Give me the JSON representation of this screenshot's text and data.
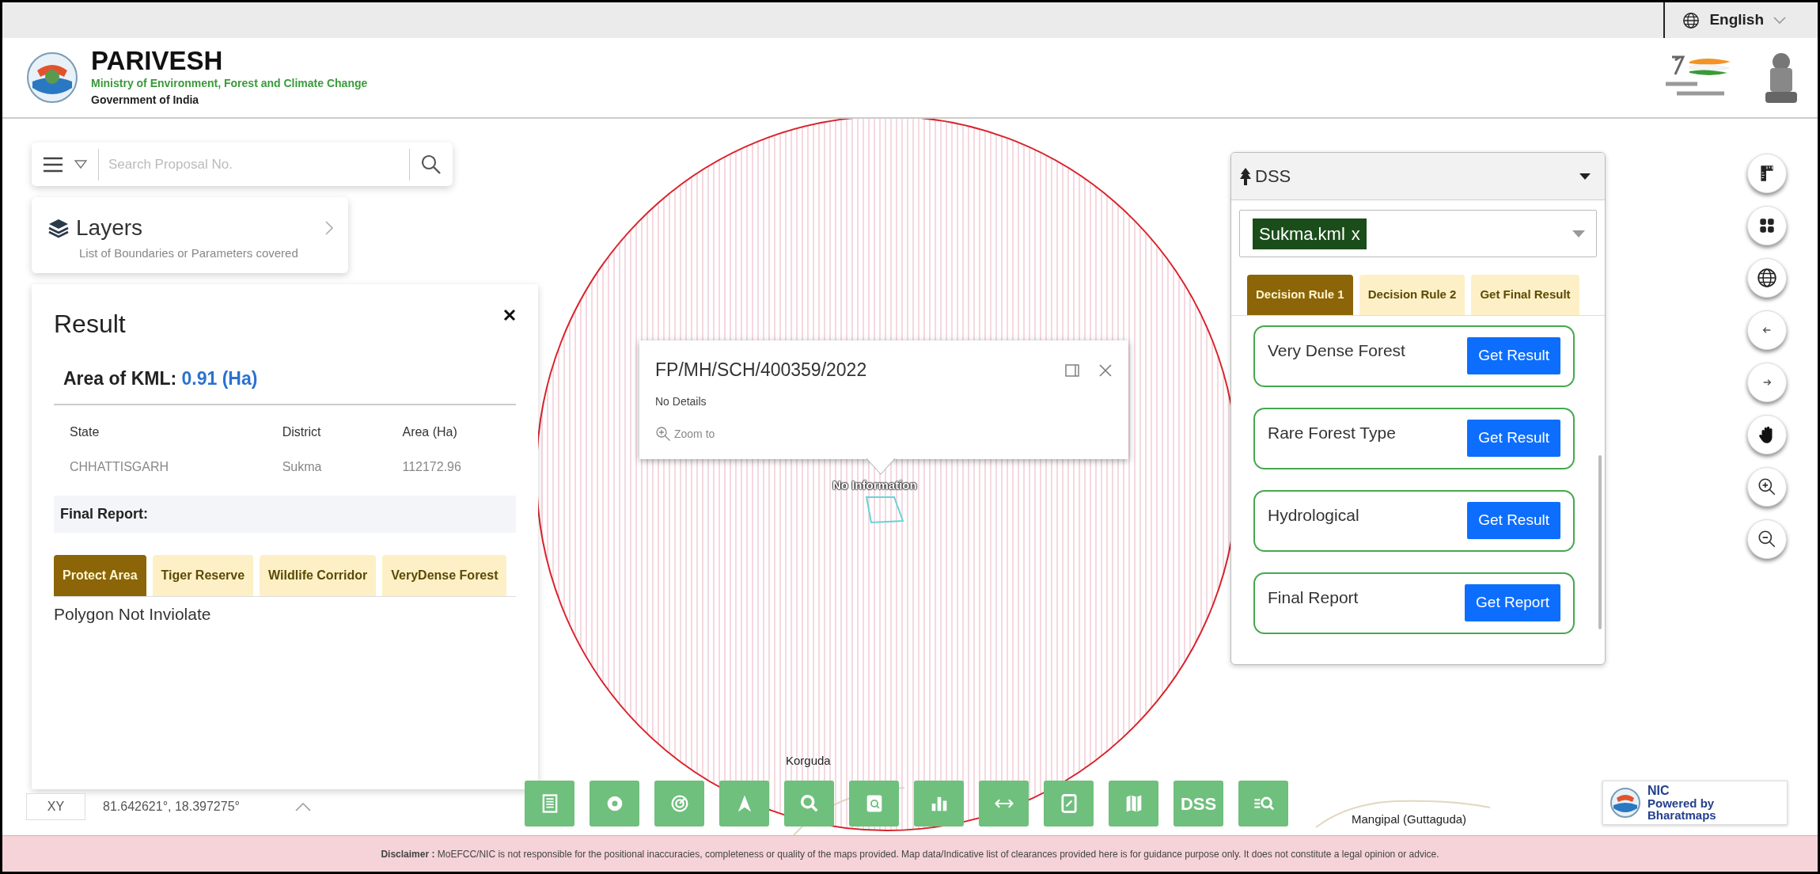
{
  "top_bar": {
    "language": "English"
  },
  "header": {
    "title": "PARIVESH",
    "ministry": "Ministry of Environment, Forest and Climate Change",
    "government": "Government of India"
  },
  "search": {
    "placeholder": "Search Proposal No."
  },
  "layers": {
    "title": "Layers",
    "subtitle": "List of Boundaries or Parameters covered"
  },
  "result_panel": {
    "title": "Result",
    "area_label": "Area of KML:",
    "area_value": "0.91 (Ha)",
    "table": {
      "columns": [
        "State",
        "District",
        "Area (Ha)"
      ],
      "rows": [
        [
          "CHHATTISGARH",
          "Sukma",
          "112172.96"
        ]
      ]
    },
    "final_report_label": "Final Report:",
    "tabs": [
      {
        "label": "Protect Area",
        "selected": true
      },
      {
        "label": "Tiger Reserve",
        "selected": false
      },
      {
        "label": "Wildlife Corridor",
        "selected": false
      },
      {
        "label": "VeryDense Forest",
        "selected": false
      }
    ],
    "message": "Polygon Not Inviolate"
  },
  "coordinates": {
    "label": "XY",
    "value": "81.642621°, 18.397275°"
  },
  "popup": {
    "title": "FP/MH/SCH/400359/2022",
    "details": "No Details",
    "zoom_link": "Zoom to"
  },
  "map_labels": [
    {
      "text": "No Information",
      "kind": "feature"
    },
    {
      "text": "Korguda",
      "kind": "place"
    },
    {
      "text": "Mangipal (Guttaguda)",
      "kind": "place"
    }
  ],
  "dss_panel": {
    "title": "DSS",
    "selected_file": "Sukma.kml",
    "remove_mark": "x",
    "tabs": [
      {
        "label": "Decision Rule 1",
        "selected": true
      },
      {
        "label": "Decision Rule 2",
        "selected": false
      },
      {
        "label": "Get Final Result",
        "selected": false
      }
    ],
    "rules": [
      {
        "label": "Very Dense Forest",
        "button": "Get Result"
      },
      {
        "label": "Rare Forest Type",
        "button": "Get Result"
      },
      {
        "label": "Hydrological",
        "button": "Get Result"
      },
      {
        "label": "Final Report",
        "button": "Get Report"
      }
    ]
  },
  "toolbar": {
    "text_button": "DSS"
  },
  "nic_badge": {
    "title": "NIC",
    "subtitle": "Powered by Bharatmaps"
  },
  "disclaimer": {
    "text": "**Disclaimer :** MoEFCC/NIC is not responsible for the positional inaccuracies, completeness or quality of the maps provided. Map data/Indicative list of clearances provided here is for guidance purpose only. It does not constitute a legal opinion or advice."
  }
}
